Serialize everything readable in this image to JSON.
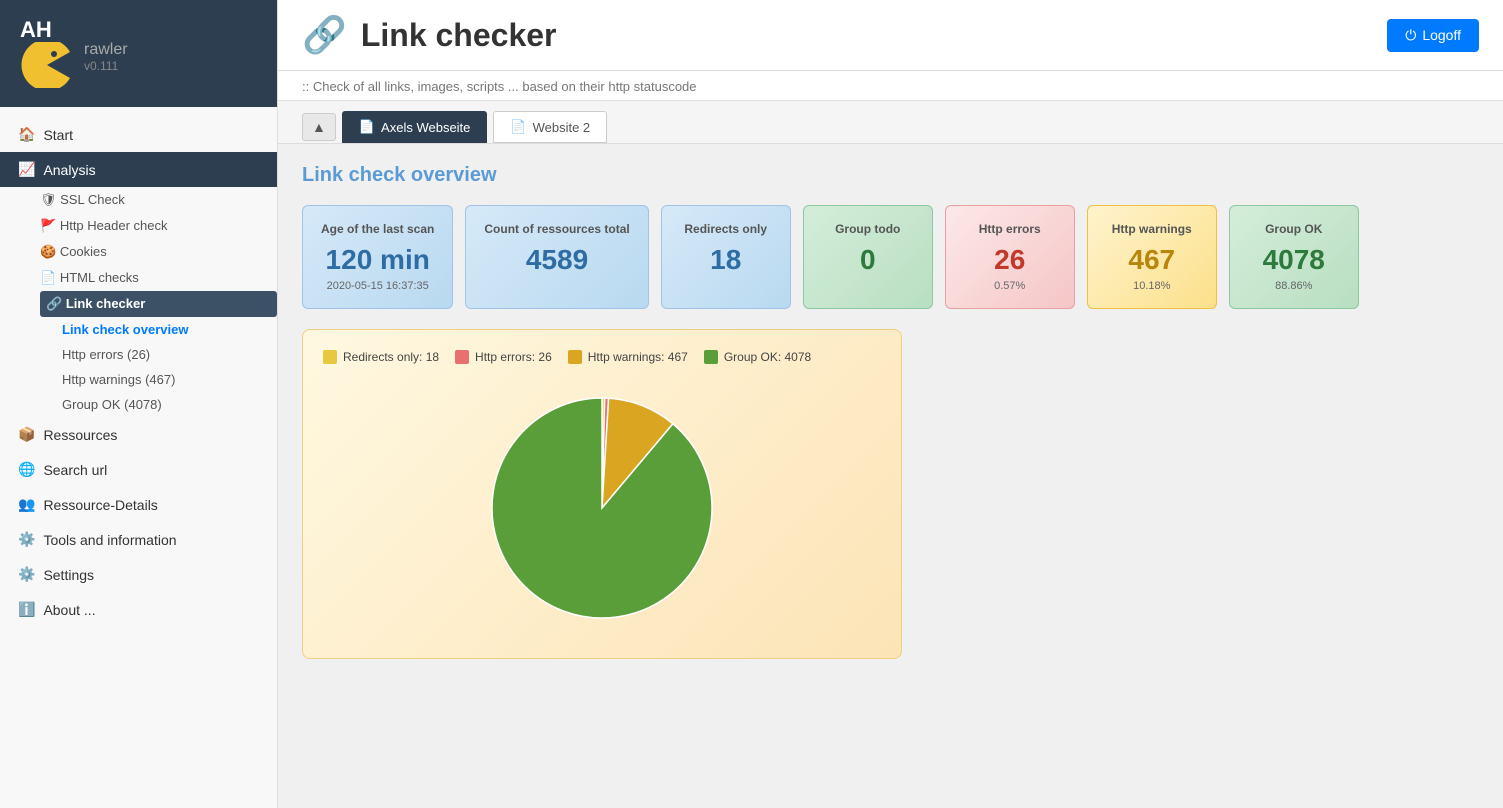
{
  "app": {
    "title_ah": "AH",
    "title_crawler": "rawler",
    "version": "v0.111"
  },
  "header": {
    "icon": "🔗",
    "title": "Link checker",
    "subtitle": ":: Check of all links, images, scripts ... based on their http statuscode",
    "logoff_label": " Logoff"
  },
  "tabs": {
    "up_icon": "▲",
    "items": [
      {
        "label": "Axels Webseite",
        "active": true
      },
      {
        "label": "Website 2",
        "active": false
      }
    ]
  },
  "sidebar": {
    "start_label": "Start",
    "analysis_label": "Analysis",
    "ssl_check_label": "SSL Check",
    "http_header_label": "Http Header check",
    "cookies_label": "Cookies",
    "html_checks_label": "HTML checks",
    "link_checker_label": "Link checker",
    "link_check_overview_label": "Link check overview",
    "http_errors_label": "Http errors (26)",
    "http_warnings_label": "Http warnings (467)",
    "group_ok_label": "Group OK (4078)",
    "ressources_label": "Ressources",
    "search_url_label": "Search url",
    "ressource_details_label": "Ressource-Details",
    "tools_label": "Tools and information",
    "settings_label": "Settings",
    "about_label": "About ..."
  },
  "overview": {
    "section_title": "Link check overview",
    "cards": [
      {
        "label": "Age of the last scan",
        "value": "120 min",
        "sub": "2020-05-15 16:37:35",
        "color": "blue",
        "bg": "blue-light"
      },
      {
        "label": "Count of ressources total",
        "value": "4589",
        "sub": "",
        "color": "blue",
        "bg": "blue-light"
      },
      {
        "label": "Redirects only",
        "value": "18",
        "sub": "",
        "color": "blue",
        "bg": "blue-light"
      },
      {
        "label": "Group todo",
        "value": "0",
        "sub": "",
        "color": "green",
        "bg": "green-light"
      },
      {
        "label": "Http errors",
        "value": "26",
        "sub": "0.57%",
        "color": "red",
        "bg": "red-light"
      },
      {
        "label": "Http warnings",
        "value": "467",
        "sub": "10.18%",
        "color": "orange",
        "bg": "orange-light"
      },
      {
        "label": "Group OK",
        "value": "4078",
        "sub": "88.86%",
        "color": "green",
        "bg": "green-light"
      }
    ],
    "chart": {
      "legend": [
        {
          "label": "Redirects only: 18",
          "color": "#e8c840"
        },
        {
          "label": "Http errors: 26",
          "color": "#e87070"
        },
        {
          "label": "Http warnings: 467",
          "color": "#daa520"
        },
        {
          "label": "Group OK: 4078",
          "color": "#5a9e3a"
        }
      ],
      "total": 4589,
      "segments": [
        {
          "value": 18,
          "color": "#e8c840"
        },
        {
          "value": 26,
          "color": "#e87070"
        },
        {
          "value": 467,
          "color": "#daa520"
        },
        {
          "value": 4078,
          "color": "#5a9e3a"
        }
      ]
    }
  }
}
